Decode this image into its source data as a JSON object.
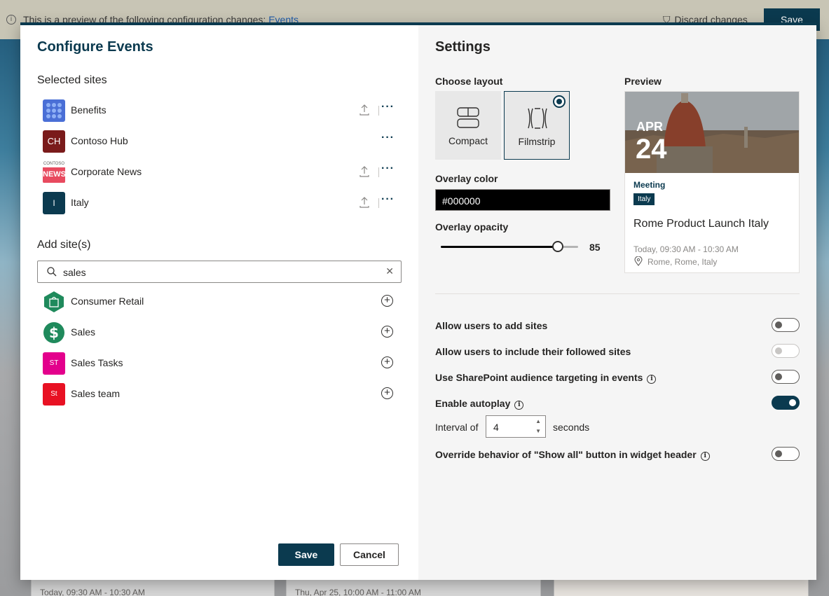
{
  "topbar": {
    "message": "This is a preview of the following configuration changes: ",
    "message_link": "Events",
    "discard": "Discard changes",
    "save": "Save"
  },
  "background_cards": [
    {
      "text": "Today, 09:30 AM - 10:30 AM"
    },
    {
      "text": "Thu, Apr 25, 10:00 AM - 11:00 AM"
    }
  ],
  "left": {
    "title": "Configure Events",
    "selected_heading": "Selected sites",
    "selected_sites": [
      {
        "name": "Benefits",
        "logo_text": "",
        "logo_color": "#4a6fd6",
        "upload": true
      },
      {
        "name": "Contoso Hub",
        "logo_text": "CH",
        "logo_color": "#7a1b1b",
        "upload": false
      },
      {
        "name": "Corporate News",
        "logo_text": "NEWS",
        "logo_sub": "CONTOSO",
        "logo_color": "#e84a5f",
        "upload": true
      },
      {
        "name": "Italy",
        "logo_text": "I",
        "logo_color": "#0b3a4f",
        "upload": true
      }
    ],
    "add_heading": "Add site(s)",
    "search": {
      "value": "sales",
      "placeholder": "Search"
    },
    "results": [
      {
        "name": "Consumer Retail",
        "logo_color": "#1f8a5c"
      },
      {
        "name": "Sales",
        "logo_color": "#1f8a5c"
      },
      {
        "name": "Sales Tasks",
        "logo_text": "ST",
        "logo_color": "#e3008c"
      },
      {
        "name": "Sales team",
        "logo_text": "St",
        "logo_color": "#e81123"
      }
    ],
    "save": "Save",
    "cancel": "Cancel"
  },
  "right": {
    "title": "Settings",
    "choose_layout": "Choose layout",
    "layouts": [
      {
        "label": "Compact",
        "selected": false
      },
      {
        "label": "Filmstrip",
        "selected": true
      }
    ],
    "preview_heading": "Preview",
    "overlay_color_label": "Overlay color",
    "overlay_color_value": "#000000",
    "overlay_opacity_label": "Overlay opacity",
    "overlay_opacity_value": "85",
    "overlay_opacity_fraction": 0.85,
    "preview": {
      "month": "APR",
      "day": "24",
      "category": "Meeting",
      "tag": "Italy",
      "title": "Rome Product Launch Italy",
      "time": "Today, 09:30 AM - 10:30 AM",
      "location": "Rome, Rome, Italy"
    },
    "options": [
      {
        "label": "Allow users to add sites",
        "info": false,
        "state": "off"
      },
      {
        "label": "Allow users to include their followed sites",
        "info": false,
        "state": "disabled"
      },
      {
        "label": "Use SharePoint audience targeting in events",
        "info": true,
        "state": "off"
      },
      {
        "label": "Enable autoplay",
        "info": true,
        "state": "on"
      },
      {
        "label": "Override behavior of \"Show all\" button in widget header",
        "info": true,
        "state": "off"
      }
    ],
    "interval": {
      "label": "Interval of",
      "value": "4",
      "unit": "seconds"
    }
  }
}
